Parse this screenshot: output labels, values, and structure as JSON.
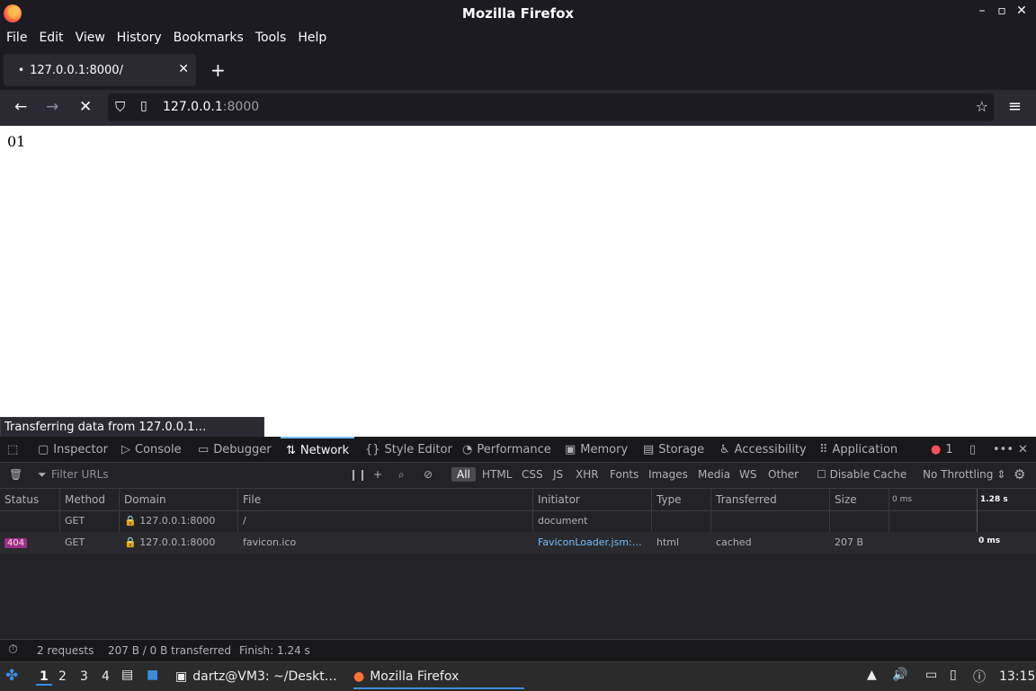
{
  "window": {
    "title": "Mozilla Firefox"
  },
  "menu": [
    "File",
    "Edit",
    "View",
    "History",
    "Bookmarks",
    "Tools",
    "Help"
  ],
  "tab": {
    "label": "127.0.0.1:8000/"
  },
  "urlbar": {
    "host": "127.0.0.1",
    "port": ":8000"
  },
  "page": {
    "text": "01"
  },
  "status_panel": {
    "text": "Transferring data from 127.0.0.1…"
  },
  "devtools": {
    "tabs": [
      "Inspector",
      "Console",
      "Debugger",
      "Network",
      "Style Editor",
      "Performance",
      "Memory",
      "Storage",
      "Accessibility",
      "Application"
    ],
    "active_tab": "Network",
    "error_count": "1",
    "filter_placeholder": "Filter URLs",
    "filters": [
      "All",
      "HTML",
      "CSS",
      "JS",
      "XHR",
      "Fonts",
      "Images",
      "Media",
      "WS",
      "Other"
    ],
    "disable_cache": "Disable Cache",
    "throttling": "No Throttling",
    "columns": [
      "Status",
      "Method",
      "Domain",
      "File",
      "Initiator",
      "Type",
      "Transferred",
      "Size"
    ],
    "timeline_labels": [
      "0 ms",
      "1.28 s"
    ],
    "rows": [
      {
        "status": "",
        "method": "GET",
        "domain": "127.0.0.1:8000",
        "file": "/",
        "initiator": "document",
        "type": "",
        "transferred": "",
        "size": "",
        "time": ""
      },
      {
        "status": "404",
        "method": "GET",
        "domain": "127.0.0.1:8000",
        "file": "favicon.ico",
        "initiator": "FaviconLoader.jsm:…",
        "type": "html",
        "transferred": "cached",
        "size": "207 B",
        "time": "0 ms"
      }
    ],
    "summary": {
      "requests": "2 requests",
      "transferred": "207 B / 0 B transferred",
      "finish": "Finish: 1.24 s"
    }
  },
  "taskbar": {
    "workspaces": [
      "1",
      "2",
      "3",
      "4"
    ],
    "items": [
      "dartz@VM3: ~/Deskt…",
      "Mozilla Firefox"
    ],
    "clock": "13:15"
  }
}
